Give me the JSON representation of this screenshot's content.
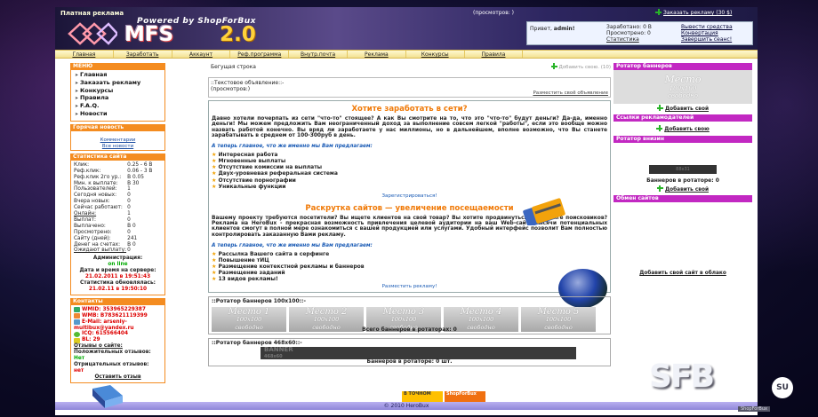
{
  "header": {
    "left_top": "Платная реклама",
    "powered": "Powered by ShopForBux",
    "logo_text": "MFS",
    "logo_ver": "2.0",
    "views": "(просмотров: )",
    "order_ad": "Заказать рекламу (30 $)",
    "greeting": "Привет,",
    "user": "admin!",
    "earned": "Заработано: 0 В",
    "viewed": "Просмотрено: 0",
    "stats": "Статистика",
    "withdraw": "Вывести средства",
    "convert": "Конвертация",
    "finish": "Завершить сеанс!"
  },
  "nav": [
    "Главная",
    "Заработать",
    "Аккаунт",
    "Реф.программа",
    "Внутр.почта",
    "Реклама",
    "Конкурсы",
    "Правила"
  ],
  "menu": {
    "title": "МЕНЮ",
    "items": [
      "Главная",
      "Заказать рекламу",
      "Конкурсы",
      "Правила",
      "F.A.Q.",
      "Новости"
    ]
  },
  "hot": {
    "title": "Горячая новость",
    "link": "Комментарии",
    "all": "Все новости"
  },
  "stats": {
    "title": "Статистика сайта",
    "rows": [
      {
        "k": "Клик:",
        "v": "0.25 - 6 В"
      },
      {
        "k": "Реф.клик:",
        "v": "0.06 - 3 В"
      },
      {
        "k": "Реф.клик 2го ур.:",
        "v": "В 0.05"
      },
      {
        "k": "Мин. к выплате:",
        "v": "В 30"
      },
      {
        "k": "Пользователей:",
        "v": "1"
      },
      {
        "k": "Сегодня новых:",
        "v": "0"
      },
      {
        "k": "Вчера новых:",
        "v": "0"
      },
      {
        "k": "Сейчас работают:",
        "v": "0"
      },
      {
        "k": "Онлайн:",
        "v": "1"
      },
      {
        "k": "Выплат:",
        "v": "0"
      },
      {
        "k": "Выплачено:",
        "v": "В 0"
      },
      {
        "k": "Просмотрено:",
        "v": "0"
      },
      {
        "k": "Сайту (дней):",
        "v": "241"
      },
      {
        "k": "Денег на счетах:",
        "v": "В 0"
      },
      {
        "k": "Ожидают выплату:",
        "v": "0"
      }
    ],
    "admin_label": "Администрация:",
    "admin_status": "on line",
    "server_label": "Дата и время на сервере:",
    "server_time": "21.02.2011 в 19:51:43",
    "updated_label": "Статистика обновлялась:",
    "updated_time": "21.02.11 в 19:50:10"
  },
  "contacts": {
    "title": "Контакты",
    "rows": [
      "WMID: 353965229387",
      "WMB: B783621119399",
      "E-Mail: arseniy-",
      "multibux@yandex.ru",
      "ICQ: 615566404",
      "BL: 29"
    ],
    "reviews": "Отзывы о сайте:",
    "pos_label": "Положительных отзывов:",
    "pos": "Нет",
    "neg_label": "Отрицательных отзывов:",
    "neg": "нет",
    "leave": "Оставить отзыв"
  },
  "ticker": {
    "label": "Бегущая строка",
    "add": "Добавить свою. (10)"
  },
  "adtext": {
    "title": "::Текстовое объявление::-",
    "views": "(просмотров:)",
    "place": "Разместить своё объявление"
  },
  "promo": {
    "h1": "Хотите заработать в сети?",
    "p1": "Давно хотели почерпать из сети \"что-то\" стоящее? А как Вы смотрите на то, что это \"что-то\" будут деньги? Да-да, именно деньги! Мы можем предложить Вам неограниченный доход за выполнение совсем легкой \"работы\", если это вообще можно назвать работой конечно. Вы вряд ли заработаете у нас миллионы, но в дальнейшем, вполне возможно, что Вы станете зарабатывать в среднем от 100-300руб в день.",
    "sub1": "А теперь главное, что же именно мы Вам предлагаем:",
    "f1": [
      "Интересная работа",
      "Мгновенные выплаты",
      "Отсутствие комиссии на выплаты",
      "Двух-уровневая реферальная система",
      "Отсутствие порнографии",
      "Уникальные функции"
    ],
    "reg": "Зарегистрироваться!",
    "h2": "Раскрутка сайтов — увеличение посещаемости",
    "p2": "Вашему проекту требуются посетители? Вы ищете клиентов на свой товар? Вы хотите продвинуться в рейтинге поисковиков? Реклама на HeroBux - прекрасная возможность привлечения целевой аудитории на ваш Web-сайт. Тысячи потенциальных клиентов смогут в полной мере ознакомиться с вашей продукцией или услугами. Удобный интерфейс позволит Вам полностью контролировать заказанную Вами рекламу.",
    "sub2": "А теперь главное, что же именно мы Вам предлагаем:",
    "f2": [
      "Рассылка Вашего сайта в серфинге",
      "Повышение тИЦ",
      "Размещение контекстной рекламы и баннеров",
      "Размещение заданий",
      "13 видов рекламы!"
    ],
    "place": "Разместить рекламу!"
  },
  "b100": {
    "title": "::Ротатор баннеров 100х100::-",
    "slots": [
      {
        "m": "Место 1",
        "s1": "100х100",
        "s2": "свободно"
      },
      {
        "m": "Место 2",
        "s1": "100х100",
        "s2": "свободно"
      },
      {
        "m": "Место 3",
        "s1": "100х100",
        "s2": "свободно"
      },
      {
        "m": "Место 4",
        "s1": "100х100",
        "s2": "свободно"
      },
      {
        "m": "Место 5",
        "s1": "100х100",
        "s2": "свободно"
      }
    ],
    "total": "Всего баннеров в ротаторах: 0"
  },
  "b468": {
    "title": "::Ротатор баннеров 468х60::-",
    "banner": "BANNER",
    "banner2": "468x60",
    "total": "Баннеров в ротаторе: 0 шт."
  },
  "footer": {
    "badge1": "В ТОЧНОМ",
    "badge2": "ShopForBux",
    "copy": "© 2010 HeroBux"
  },
  "right": {
    "r1": "Ротатор баннеров",
    "r1_m": "Место",
    "r1_s1": "100х100",
    "r1_s2": "свободно",
    "add": "Добавить свой",
    "r2": "Ссылки рекламодателей",
    "add2": "Добавить свою",
    "r3": "Ротатор внизин",
    "b88": "88х31",
    "r3_count": "Баннеров в ротаторе: 0",
    "add3": "Добавить свой",
    "r4": "Обмен сайтов",
    "link4": "Добавить свой сайт в облако"
  },
  "watermark": {
    "text": "SFB",
    "su": "SU",
    "dom": "ShopForBux"
  }
}
